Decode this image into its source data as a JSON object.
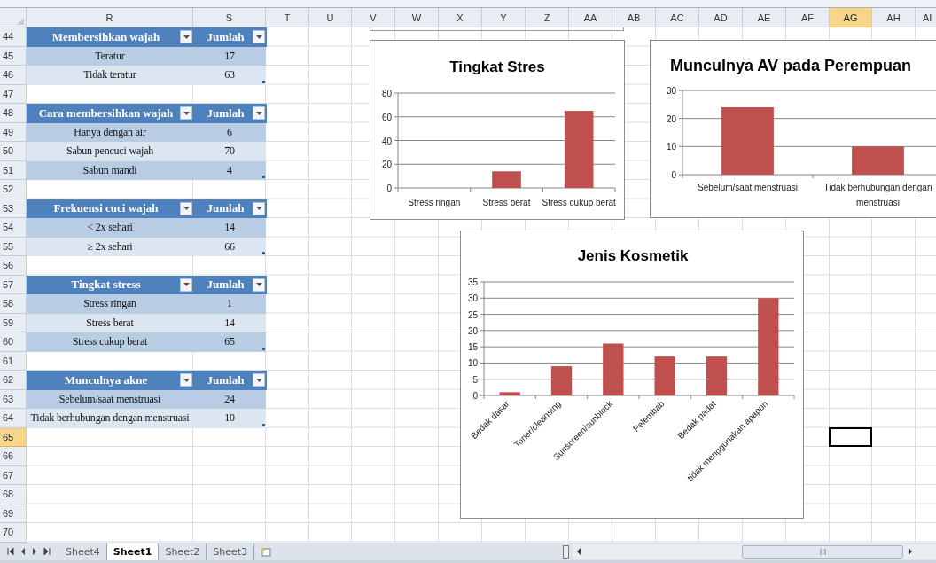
{
  "columns": [
    {
      "label": "R",
      "selected": false
    },
    {
      "label": "S",
      "selected": false
    },
    {
      "label": "T",
      "selected": false
    },
    {
      "label": "U",
      "selected": false
    },
    {
      "label": "V",
      "selected": false
    },
    {
      "label": "W",
      "selected": false
    },
    {
      "label": "X",
      "selected": false
    },
    {
      "label": "Y",
      "selected": false
    },
    {
      "label": "Z",
      "selected": false
    },
    {
      "label": "AA",
      "selected": false
    },
    {
      "label": "AB",
      "selected": false
    },
    {
      "label": "AC",
      "selected": false
    },
    {
      "label": "AD",
      "selected": false
    },
    {
      "label": "AE",
      "selected": false
    },
    {
      "label": "AF",
      "selected": false
    },
    {
      "label": "AG",
      "selected": true
    },
    {
      "label": "AH",
      "selected": false
    },
    {
      "label": "AI",
      "selected": false
    }
  ],
  "rows": [
    {
      "label": "44",
      "selected": false
    },
    {
      "label": "45",
      "selected": false
    },
    {
      "label": "46",
      "selected": false
    },
    {
      "label": "47",
      "selected": false
    },
    {
      "label": "48",
      "selected": false
    },
    {
      "label": "49",
      "selected": false
    },
    {
      "label": "50",
      "selected": false
    },
    {
      "label": "51",
      "selected": false
    },
    {
      "label": "52",
      "selected": false
    },
    {
      "label": "53",
      "selected": false
    },
    {
      "label": "54",
      "selected": false
    },
    {
      "label": "55",
      "selected": false
    },
    {
      "label": "56",
      "selected": false
    },
    {
      "label": "57",
      "selected": false
    },
    {
      "label": "58",
      "selected": false
    },
    {
      "label": "59",
      "selected": false
    },
    {
      "label": "60",
      "selected": false
    },
    {
      "label": "61",
      "selected": false
    },
    {
      "label": "62",
      "selected": false
    },
    {
      "label": "63",
      "selected": false
    },
    {
      "label": "64",
      "selected": false
    },
    {
      "label": "65",
      "selected": true
    },
    {
      "label": "66",
      "selected": false
    },
    {
      "label": "67",
      "selected": false
    },
    {
      "label": "68",
      "selected": false
    },
    {
      "label": "69",
      "selected": false
    },
    {
      "label": "70",
      "selected": false
    }
  ],
  "tables": [
    {
      "columns": [
        "Membersihkan wajah",
        "Jumlah"
      ],
      "rows": [
        [
          "Teratur",
          "17"
        ],
        [
          "Tidak teratur",
          "63"
        ]
      ]
    },
    {
      "columns": [
        "Cara membersihkan wajah",
        "Jumlah"
      ],
      "rows": [
        [
          "Hanya dengan air",
          "6"
        ],
        [
          "Sabun pencuci wajah",
          "70"
        ],
        [
          "Sabun mandi",
          "4"
        ]
      ]
    },
    {
      "columns": [
        "Frekuensi cuci wajah",
        "Jumlah"
      ],
      "rows": [
        [
          "< 2x sehari",
          "14"
        ],
        [
          "≥ 2x sehari",
          "66"
        ]
      ]
    },
    {
      "columns": [
        "Tingkat stress",
        "Jumlah"
      ],
      "rows": [
        [
          "Stress ringan",
          "1"
        ],
        [
          "Stress berat",
          "14"
        ],
        [
          "Stress cukup berat",
          "65"
        ]
      ]
    },
    {
      "columns": [
        "Munculnya akne",
        "Jumlah"
      ],
      "rows": [
        [
          "Sebelum/saat menstruasi",
          "24"
        ],
        [
          "Tidak berhubungan dengan menstruasi",
          "10"
        ]
      ]
    }
  ],
  "charts": [
    {
      "chart_data": {
        "type": "bar",
        "title": "Tingkat Stres",
        "categories": [
          "Stress ringan",
          "Stress berat",
          "Stress cukup berat"
        ],
        "series": [
          {
            "color": "#c0504d",
            "values": [
              null,
              14,
              65
            ]
          }
        ],
        "ylim": [
          0,
          80
        ],
        "grid": true,
        "yticks": [
          0,
          20,
          40,
          60,
          80
        ]
      }
    },
    {
      "chart_data": {
        "type": "bar",
        "title": "Munculnya AV pada Perempuan",
        "categories": [
          "Sebelum/saat menstruasi",
          "Tidak berhubungan dengan menstruasi"
        ],
        "series": [
          {
            "color": "#c0504d",
            "values": [
              24,
              10
            ]
          }
        ],
        "ylim": [
          0,
          30
        ],
        "grid": true,
        "yticks": [
          0,
          10,
          20,
          30
        ]
      }
    },
    {
      "chart_data": {
        "type": "bar",
        "title": "Jenis Kosmetik",
        "categories": [
          "Bedak dasar",
          "Toner/cleansing",
          "Sunscreen/sunblock",
          "Pelembab",
          "Bedak padat",
          "tidak menggunakan apapun"
        ],
        "series": [
          {
            "color": "#c0504d",
            "values": [
              1,
              9,
              16,
              12,
              12,
              30
            ]
          }
        ],
        "ylim": [
          0,
          35
        ],
        "grid": true,
        "yticks": [
          0,
          5,
          10,
          15,
          20,
          25,
          30,
          35
        ]
      }
    }
  ],
  "sheet_tabs": [
    {
      "label": "Sheet4",
      "selected": false
    },
    {
      "label": "Sheet1",
      "selected": true
    },
    {
      "label": "Sheet2",
      "selected": false
    },
    {
      "label": "Sheet3",
      "selected": false
    }
  ]
}
